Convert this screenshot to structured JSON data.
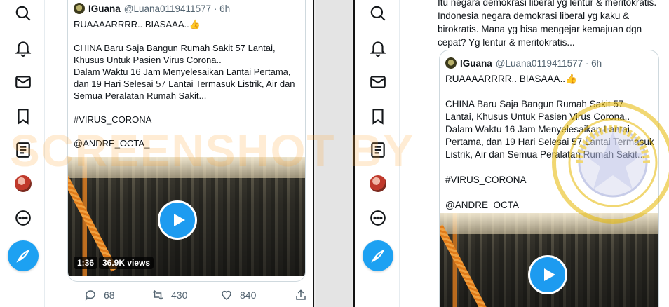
{
  "left_tweet": {
    "quote": {
      "name": "IGuana",
      "handle_time": "@Luana0119411577 · 6h",
      "text": "RUAAAARRRR.. BIASAAA..👍\n\nCHINA Baru Saja Bangun Rumah Sakit 57 Lantai, Khusus Untuk Pasien Virus Corona..\nDalam Waktu 16 Jam Menyelesaikan Lantai Pertama, dan 19 Hari Selesai 57 Lantai Termasuk Listrik, Air dan Semua Peralatan Rumah Sakit...\n\n#VIRUS_CORONA\n\n@ANDRE_OCTA_",
      "video_duration": "1:36",
      "video_views": "36.9K views"
    },
    "actions": {
      "replies": "68",
      "retweets": "430",
      "likes": "840"
    }
  },
  "right_tweet": {
    "body_text": "Itu negara demokrasi liberal yg lentur & meritokratis.\nIndonesia negara demokrasi liberal yg kaku & birokratis. Mana yg bisa mengejar kemajuan dgn cepat? Yg lentur & meritokratis...",
    "quote": {
      "name": "IGuana",
      "handle_time": "@Luana0119411577 · 6h",
      "text": "RUAAAARRRR.. BIASAAA..👍\n\nCHINA Baru Saja Bangun Rumah Sakit 57 Lantai, Khusus Untuk Pasien Virus Corona..\nDalam Waktu 16 Jam Menyelesaikan Lantai Pertama, dan 19 Hari Selesai 57 Lantai Termasuk Listrik, Air dan Semua Peralatan Rumah Sakit...\n\n#VIRUS_CORONA\n\n@ANDRE_OCTA_"
    }
  },
  "sidebar_icons": [
    "search-icon",
    "bell-icon",
    "mail-icon",
    "bookmark-icon",
    "list-icon",
    "avatar",
    "more-icon",
    "compose-icon"
  ],
  "watermark": "SCREENSHOT BY",
  "seal_text": "MASYARAKAT ANTI FITNAH INDONESIA · MAFINDO · CEK HOAX",
  "colors": {
    "accent": "#1da1f2",
    "watermark": "#ffaa3c",
    "seal": "#e6b800"
  }
}
